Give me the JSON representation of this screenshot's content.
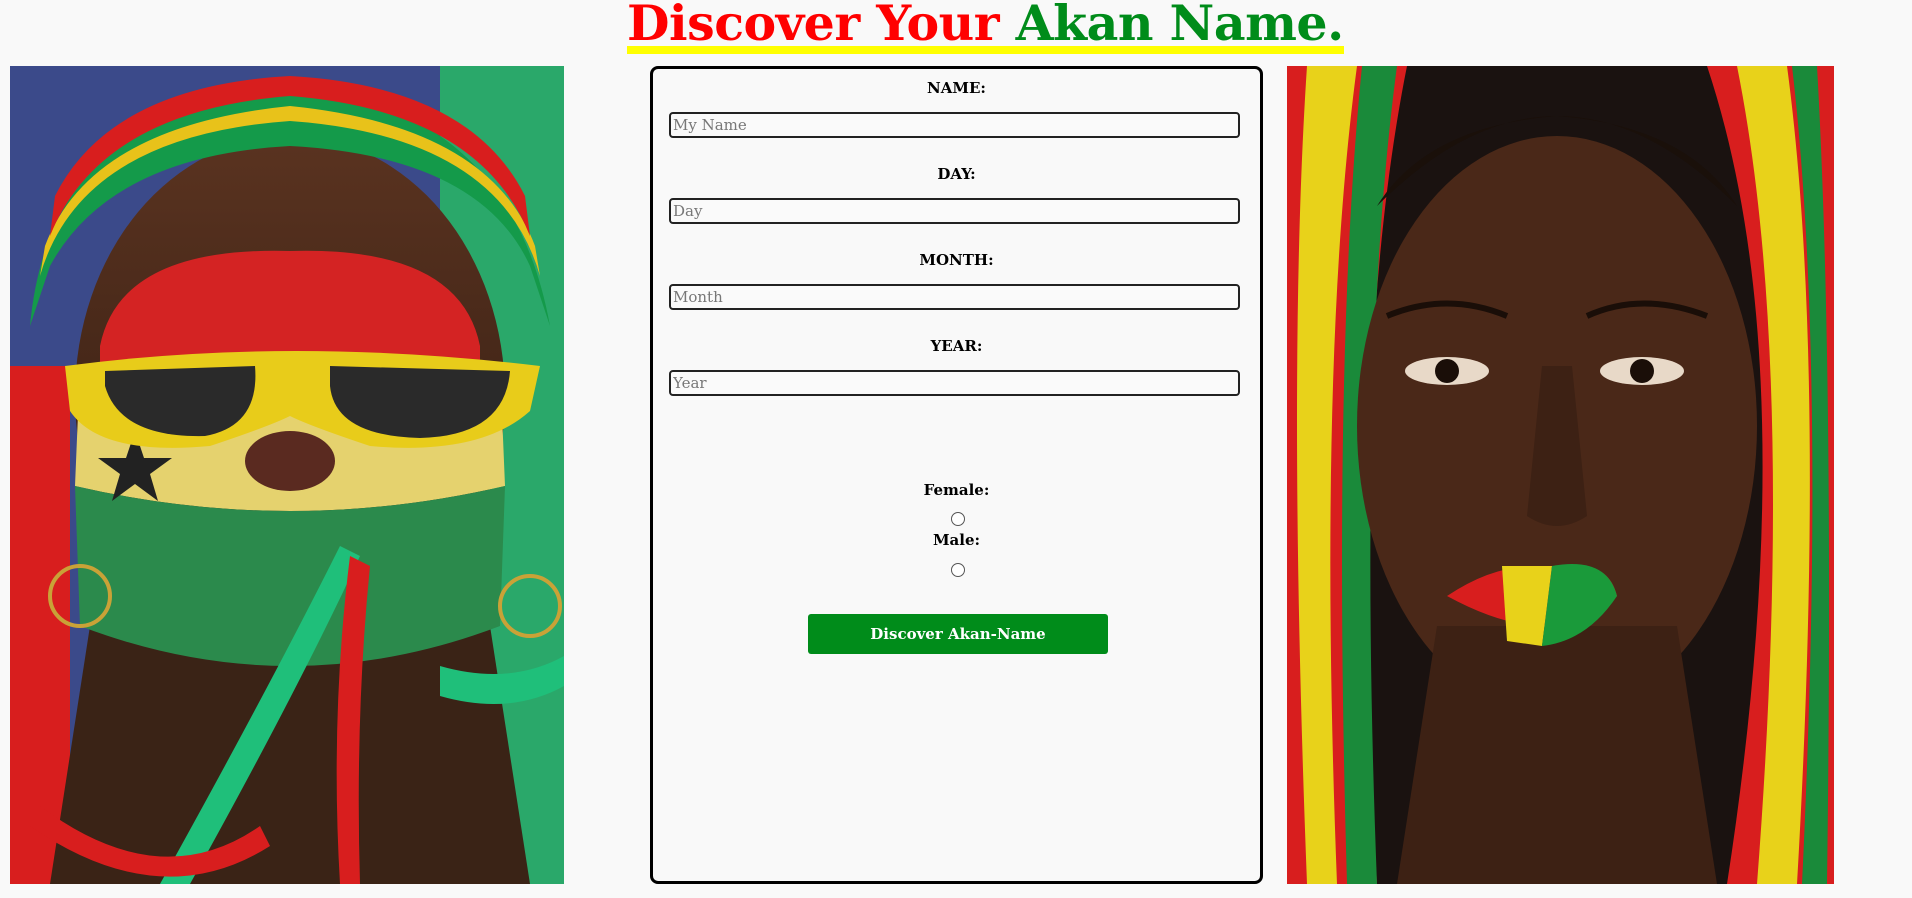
{
  "header": {
    "title_part1": "Discover Your",
    "title_part2": "Akan Name."
  },
  "colors": {
    "red": "#ff0000",
    "green": "#008c1a",
    "yellow": "#ffff00"
  },
  "images": {
    "left": "ghana-fan-face-paint-photo",
    "right": "woman-kente-headscarf-photo"
  },
  "form": {
    "name_label": "NAME:",
    "name_placeholder": "My Name",
    "day_label": "DAY:",
    "day_placeholder": "Day",
    "month_label": "MONTH:",
    "month_placeholder": "Month",
    "year_label": "YEAR:",
    "year_placeholder": "Year",
    "female_label": "Female:",
    "male_label": "Male:",
    "submit_label": "Discover Akan-Name"
  }
}
